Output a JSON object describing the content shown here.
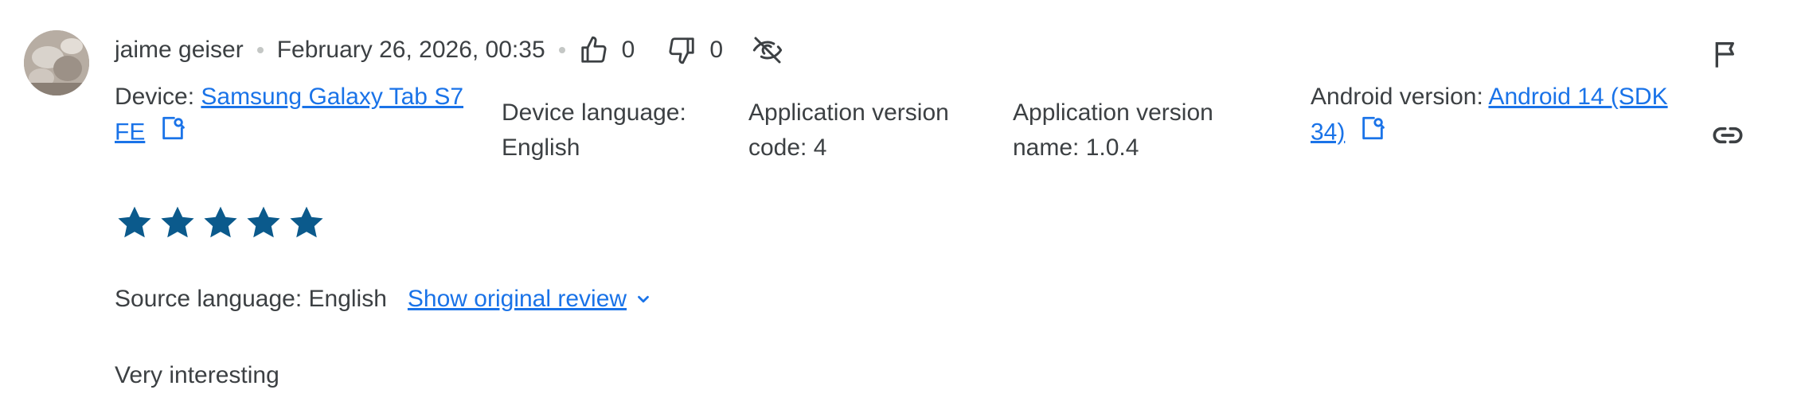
{
  "review": {
    "author": "jaime geiser",
    "date": "February 26, 2026, 00:35",
    "likes": "0",
    "dislikes": "0",
    "rating": 5,
    "rating_color": "#0b5a8c",
    "source_language": "Source language: English",
    "show_original": "Show original review",
    "text": "Very interesting"
  },
  "device": {
    "label": "Device: ",
    "value_line1": "Samsung Galaxy Tab S7",
    "value_line2": "FE"
  },
  "device_language": {
    "line1": "Device language:",
    "line2": "English"
  },
  "app_version_code": {
    "line1": "Application version",
    "line2": "code: 4"
  },
  "app_version_name": {
    "line1": "Application version",
    "line2": "name: 1.0.4"
  },
  "android_version": {
    "label": "Android version: ",
    "value_line1": "Android 14 (SDK",
    "value_line2": "34)"
  },
  "icons": {
    "like": "thumbs-up-icon",
    "dislike": "thumbs-down-icon",
    "visibility": "visibility-off-icon",
    "flag": "flag-icon",
    "link": "link-icon",
    "copy": "open-in-new-icon",
    "expand": "chevron-down-icon"
  },
  "colors": {
    "link": "#1a73e8",
    "text": "#3c4043",
    "star": "#0b5a8c"
  }
}
